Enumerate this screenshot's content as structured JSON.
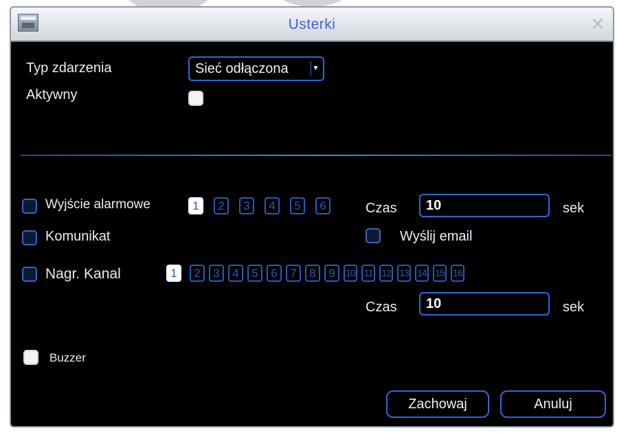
{
  "window": {
    "title": "Usterki"
  },
  "event": {
    "type_label": "Typ zdarzenia",
    "type_value": "Sieć odłączona",
    "active_label": "Aktywny",
    "active_checked": false
  },
  "alarm_output": {
    "label": "Wyjście alarmowe",
    "channels": [
      "1",
      "2",
      "3",
      "4",
      "5",
      "6"
    ],
    "selected": "1",
    "time_label": "Czas",
    "time_value": "10",
    "unit": "sek"
  },
  "message": {
    "label": "Komunikat",
    "email_label": "Wyślij email"
  },
  "record": {
    "label": "Nagr. Kanal",
    "channels": [
      "1",
      "2",
      "3",
      "4",
      "5",
      "6",
      "7",
      "8",
      "9",
      "10",
      "11",
      "12",
      "13",
      "14",
      "15",
      "16"
    ],
    "selected": "1",
    "time_label": "Czas",
    "time_value": "10",
    "unit": "sek"
  },
  "buzzer": {
    "label": "Buzzer",
    "checked": true
  },
  "buttons": {
    "save": "Zachowaj",
    "cancel": "Anuluj"
  },
  "colors": {
    "accent": "#2d69d8",
    "background": "#000000",
    "title": "#3a63d8"
  }
}
